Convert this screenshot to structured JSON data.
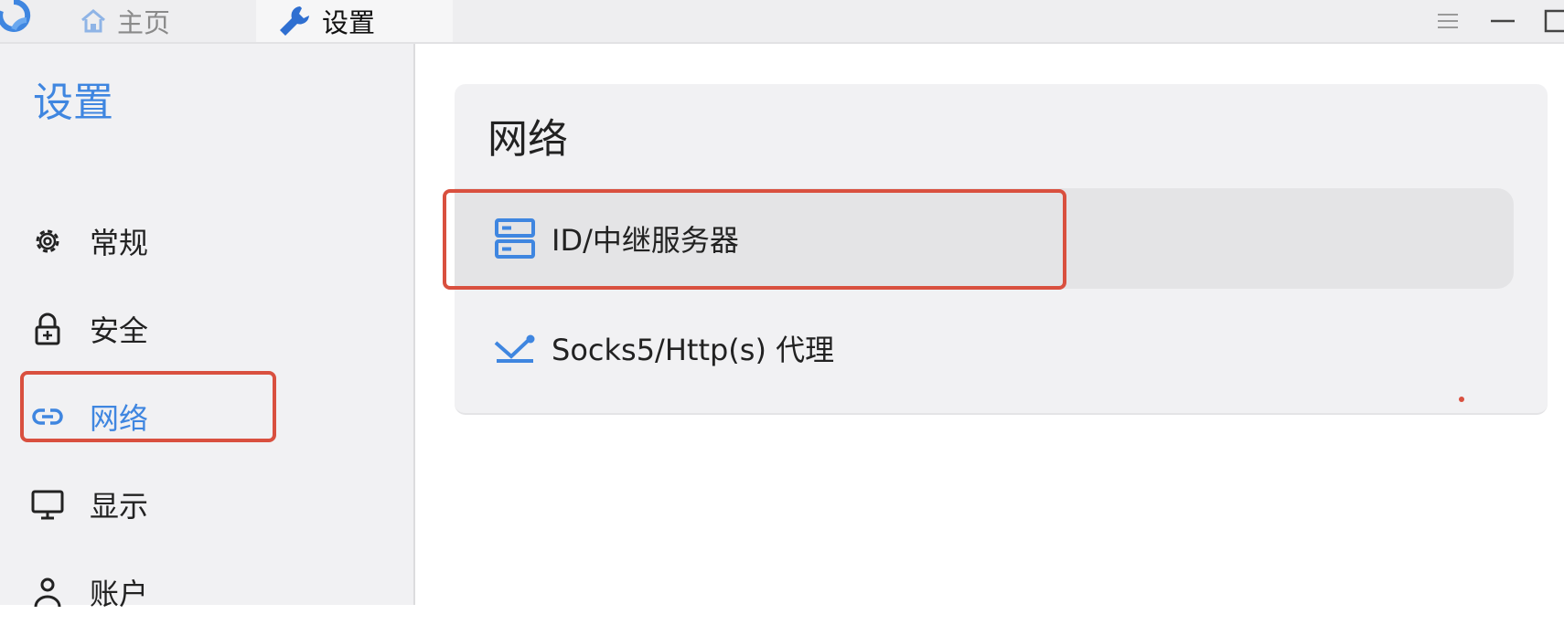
{
  "titlebar": {
    "tabs": [
      {
        "label": "主页",
        "icon": "home-icon"
      },
      {
        "label": "设置",
        "icon": "wrench-icon"
      }
    ],
    "window_controls": [
      "menu-icon",
      "minimize-icon",
      "maximize-icon"
    ]
  },
  "sidebar": {
    "title": "设置",
    "items": [
      {
        "label": "常规",
        "icon": "gear-icon"
      },
      {
        "label": "安全",
        "icon": "lock-icon"
      },
      {
        "label": "网络",
        "icon": "link-icon",
        "active": true
      },
      {
        "label": "显示",
        "icon": "monitor-icon"
      },
      {
        "label": "账户",
        "icon": "user-icon"
      }
    ]
  },
  "main": {
    "section_title": "网络",
    "rows": [
      {
        "label": "ID/中继服务器",
        "icon": "server-icon"
      },
      {
        "label": "Socks5/Http(s) 代理",
        "icon": "proxy-icon"
      }
    ]
  },
  "colors": {
    "accent": "#3f86e0",
    "highlight": "#d9503f",
    "sidebar_bg": "#f1f1f3"
  }
}
